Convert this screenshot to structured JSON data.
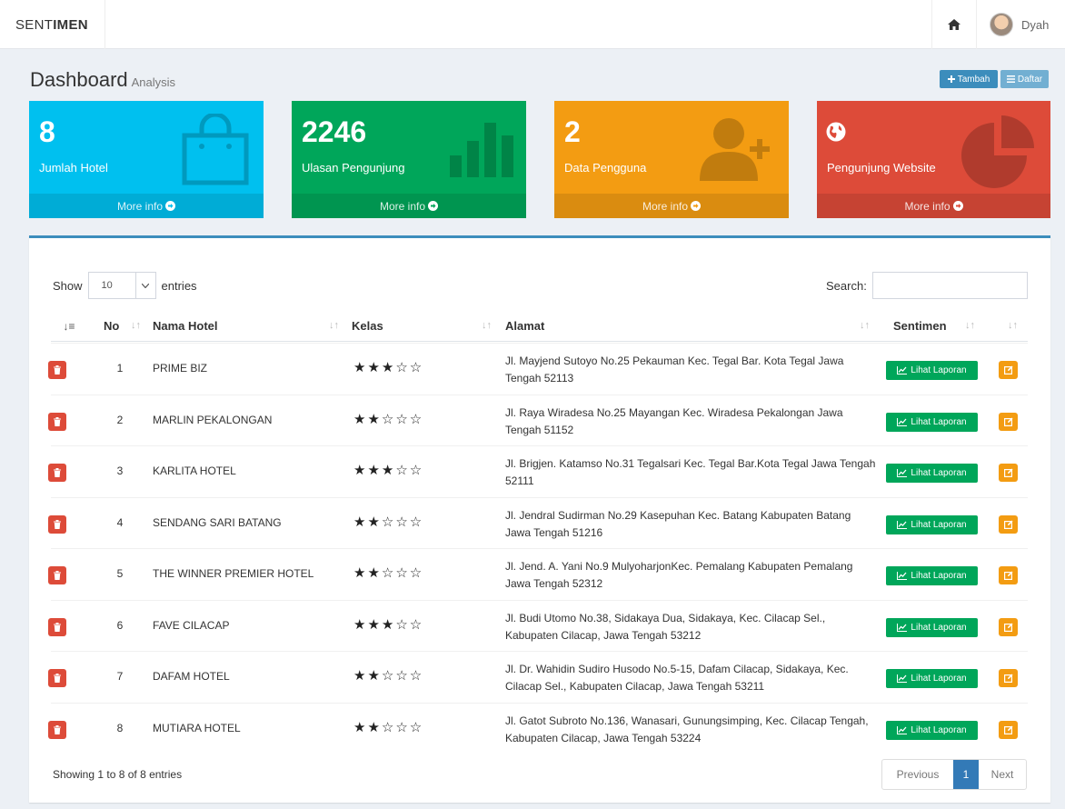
{
  "brand": {
    "light": "SENT",
    "bold": "IMEN"
  },
  "user": {
    "name": "Dyah"
  },
  "header": {
    "title": "Dashboard",
    "subtitle": "Analysis",
    "add_label": "Tambah",
    "list_label": "Daftar"
  },
  "boxes": [
    {
      "value": "8",
      "label": "Jumlah Hotel",
      "more": "More info",
      "color": "#00c0ef",
      "icon": "shopping-bag-icon"
    },
    {
      "value": "2246",
      "label": "Ulasan Pengunjung",
      "more": "More info",
      "color": "#00a65a",
      "icon": "bar-chart-icon"
    },
    {
      "value": "2",
      "label": "Data Pengguna",
      "more": "More info",
      "color": "#f39c12",
      "icon": "user-plus-icon"
    },
    {
      "value": "",
      "label": "Pengunjung Website",
      "more": "More info",
      "color": "#dd4b39",
      "icon": "pie-chart-icon"
    }
  ],
  "table": {
    "length_label_before": "Show",
    "length_value": "10",
    "length_label_after": "entries",
    "search_label": "Search:",
    "columns": [
      "No",
      "Nama Hotel",
      "Kelas",
      "Alamat",
      "Sentimen"
    ],
    "report_label": "Lihat Laporan",
    "rows": [
      {
        "no": "1",
        "name": "PRIME BIZ",
        "stars": 3,
        "address": "Jl. Mayjend Sutoyo No.25 Pekauman Kec. Tegal Bar. Kota Tegal Jawa Tengah 52113"
      },
      {
        "no": "2",
        "name": "MARLIN PEKALONGAN",
        "stars": 2,
        "address": "Jl. Raya Wiradesa No.25 Mayangan Kec. Wiradesa Pekalongan Jawa Tengah 51152"
      },
      {
        "no": "3",
        "name": "KARLITA HOTEL",
        "stars": 3,
        "address": "Jl. Brigjen. Katamso No.31 Tegalsari Kec. Tegal Bar.Kota Tegal Jawa Tengah 52111"
      },
      {
        "no": "4",
        "name": "SENDANG SARI BATANG",
        "stars": 2,
        "address": "Jl. Jendral Sudirman No.29 Kasepuhan Kec. Batang Kabupaten Batang Jawa Tengah 51216"
      },
      {
        "no": "5",
        "name": "THE WINNER PREMIER HOTEL",
        "stars": 2,
        "address": "Jl. Jend. A. Yani No.9 MulyoharjonKec. Pemalang Kabupaten Pemalang Jawa Tengah 52312"
      },
      {
        "no": "6",
        "name": "FAVE CILACAP",
        "stars": 3,
        "address": "Jl. Budi Utomo No.38, Sidakaya Dua, Sidakaya, Kec. Cilacap Sel., Kabupaten Cilacap, Jawa Tengah 53212"
      },
      {
        "no": "7",
        "name": "DAFAM HOTEL",
        "stars": 2,
        "address": "Jl. Dr. Wahidin Sudiro Husodo No.5-15, Dafam Cilacap, Sidakaya, Kec. Cilacap Sel., Kabupaten Cilacap, Jawa Tengah 53211"
      },
      {
        "no": "8",
        "name": "MUTIARA HOTEL",
        "stars": 2,
        "address": "Jl. Gatot Subroto No.136, Wanasari, Gunungsimping, Kec. Cilacap Tengah, Kabupaten Cilacap, Jawa Tengah 53224"
      }
    ],
    "info": "Showing 1 to 8 of 8 entries",
    "pagination": {
      "prev": "Previous",
      "current": "1",
      "next": "Next"
    }
  }
}
